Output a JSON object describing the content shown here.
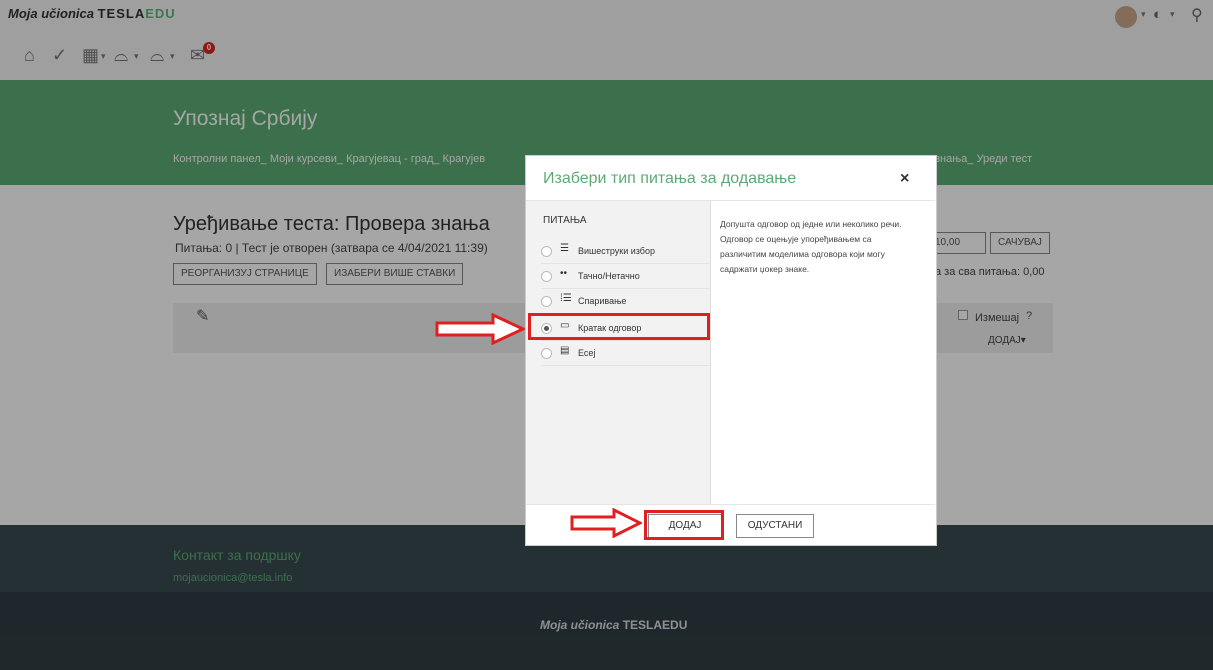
{
  "brand": {
    "italic": "Moja učionica",
    "tesla": "TESLA",
    "edu": "EDU"
  },
  "toolbar": {
    "notification_count": "0"
  },
  "course": {
    "title": "Упознај Србију",
    "breadcrumb": {
      "left": "Контролни панел_ Моји курсеви_ Крагујевац - град_ Крагујев",
      "right": "знања_ Уреди тест"
    }
  },
  "page": {
    "title": "Уређивање теста: Провера знања",
    "info": "Питања: 0 | Тест је отворен (затвара се 4/04/2021 11:39)",
    "btn_reorganize": "РЕОРГАНИЗУЈ СТРАНИЦЕ",
    "btn_select_multiple": "ИЗАБЕРИ ВИШЕ СТАВКИ",
    "max_grade": "10,00",
    "btn_save": "САЧУВАЈ",
    "total_marks": "а за сва питања: 0,00",
    "shuffle_label": "Измешај",
    "add_label": "ДОДАЈ"
  },
  "footer": {
    "contact_title": "Контакт за подршку",
    "contact_email": "mojaucionica@tesla.info"
  },
  "dialog": {
    "title": "Изабери тип питања за додавање",
    "close": "×",
    "section": "ПИТАЊА",
    "options": [
      {
        "label": "Вишеструки избор",
        "icon": "list-icon",
        "selected": false
      },
      {
        "label": "Тачно/Нетачно",
        "icon": "dots-icon",
        "selected": false
      },
      {
        "label": "Спаривање",
        "icon": "matching-icon",
        "selected": false
      },
      {
        "label": "Кратак одговор",
        "icon": "short-answer-icon",
        "selected": true
      },
      {
        "label": "Есеј",
        "icon": "essay-icon",
        "selected": false
      }
    ],
    "description": "Допушта одговор од једне или неколико речи. Одговор се оцењује упоређивањем са различитим моделима одговора који могу садржати џокер знаке.",
    "btn_add": "ДОДАЈ",
    "btn_cancel": "ОДУСТАНИ"
  },
  "colors": {
    "accent": "#5cab73",
    "highlight": "#e02020"
  }
}
